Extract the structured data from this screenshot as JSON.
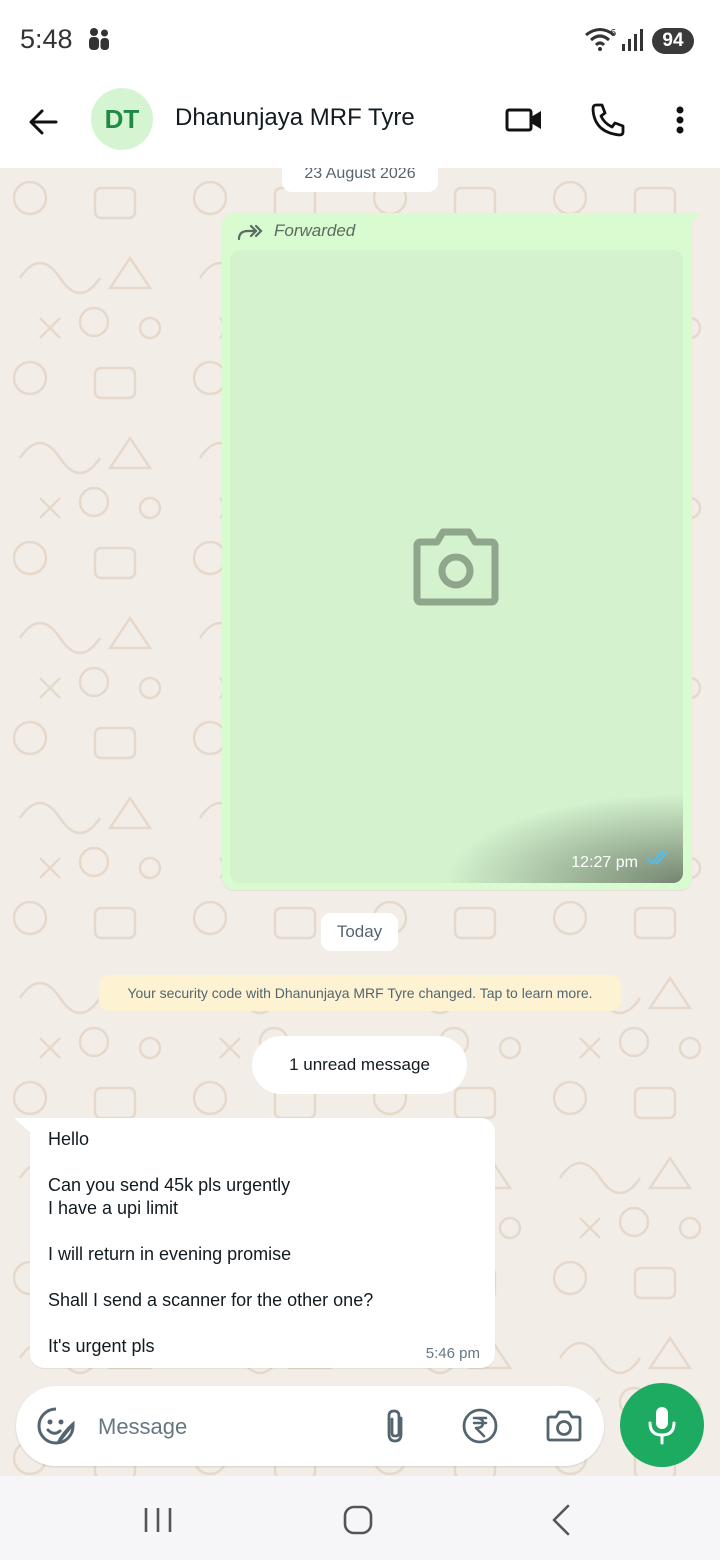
{
  "status_bar": {
    "time": "5:48",
    "battery": "94"
  },
  "header": {
    "avatar_initials": "DT",
    "contact_name": "Dhanunjaya MRF Tyre"
  },
  "chat": {
    "date_separator": "23 August 2026",
    "forwarded_message": {
      "forwarded_label": "Forwarded",
      "time": "12:27 pm",
      "status": "read"
    },
    "today_separator": "Today",
    "security_notice": "Your security code with Dhanunjaya MRF Tyre changed. Tap to learn more.",
    "unread_indicator": "1 unread message",
    "incoming_message": {
      "text": "Hello\n\nCan you send 45k pls urgently\nI have a upi limit\n\nI will return in evening promise\n\nShall I send a scanner for the other one?\n\nIt's urgent pls",
      "time": "5:46 pm"
    }
  },
  "composer": {
    "placeholder": "Message"
  },
  "colors": {
    "accent_green": "#1daa61",
    "outgoing_bubble": "#d8fbd0",
    "read_ticks": "#53bdeb",
    "wallpaper": "#f2ede6"
  },
  "icons": {
    "header": [
      "back-arrow-icon",
      "video-call-icon",
      "phone-icon",
      "more-vert-icon"
    ],
    "composer": [
      "sticker-icon",
      "attach-icon",
      "rupee-payment-icon",
      "camera-icon",
      "mic-icon"
    ],
    "nav": [
      "recents-icon",
      "home-icon",
      "back-icon"
    ]
  }
}
